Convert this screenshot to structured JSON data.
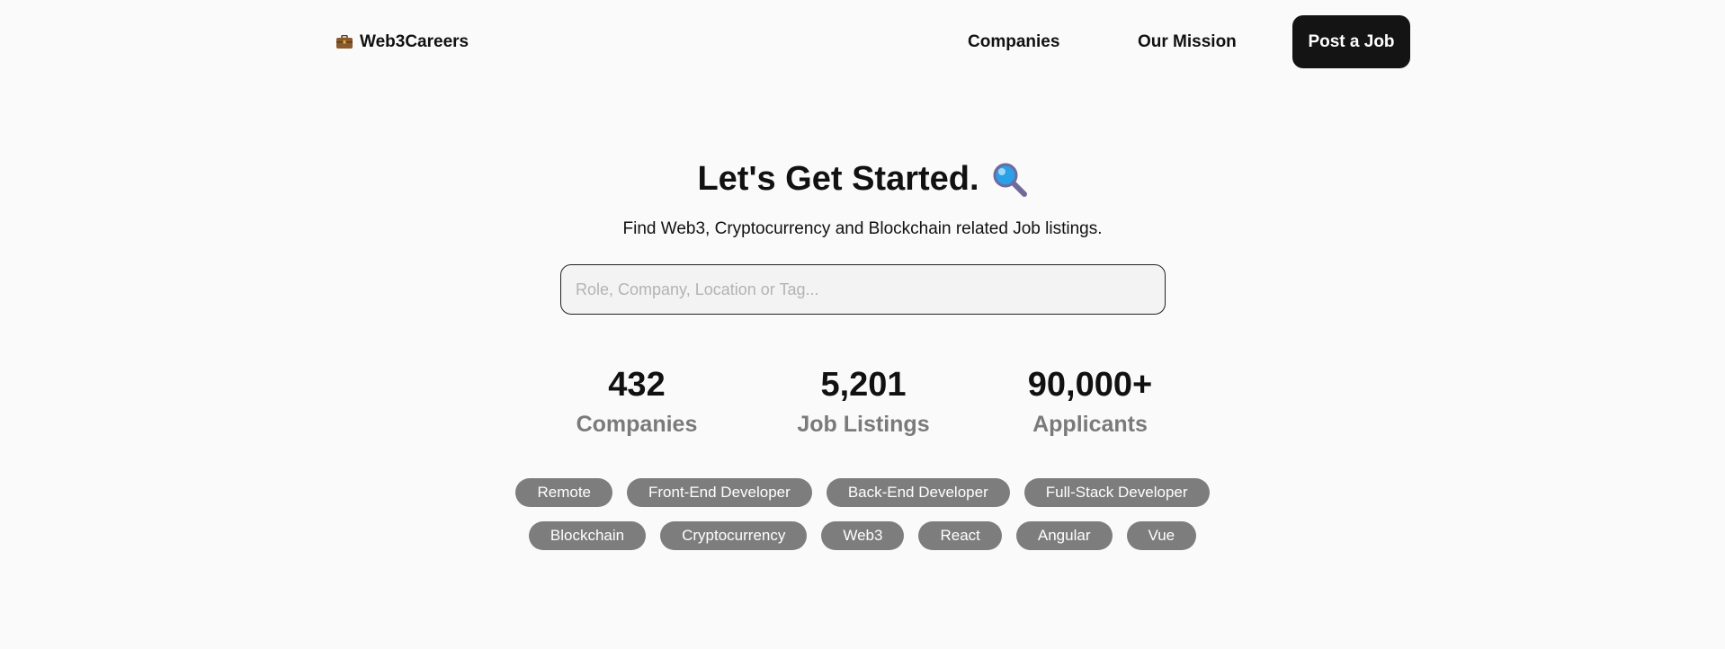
{
  "header": {
    "brand_label": "Web3Careers",
    "brand_icon": "briefcase-icon",
    "nav": {
      "companies_label": "Companies",
      "mission_label": "Our Mission",
      "post_job_label": "Post a Job"
    }
  },
  "hero": {
    "title": "Let's Get Started.",
    "title_icon": "magnifying-glass-icon",
    "subtitle": "Find Web3, Cryptocurrency and Blockchain related Job listings.",
    "search_placeholder": "Role, Company, Location or Tag...",
    "search_value": ""
  },
  "stats": [
    {
      "value": "432",
      "label": "Companies"
    },
    {
      "value": "5,201",
      "label": "Job Listings"
    },
    {
      "value": "90,000+",
      "label": "Applicants"
    }
  ],
  "tags": {
    "row1": [
      "Remote",
      "Front-End Developer",
      "Back-End Developer",
      "Full-Stack Developer"
    ],
    "row2": [
      "Blockchain",
      "Cryptocurrency",
      "Web3",
      "React",
      "Angular",
      "Vue"
    ]
  },
  "colors": {
    "background": "#fafafa",
    "primary_button": "#141414",
    "tag_background": "#7d7d7d",
    "stat_label": "#7a7a7a"
  }
}
